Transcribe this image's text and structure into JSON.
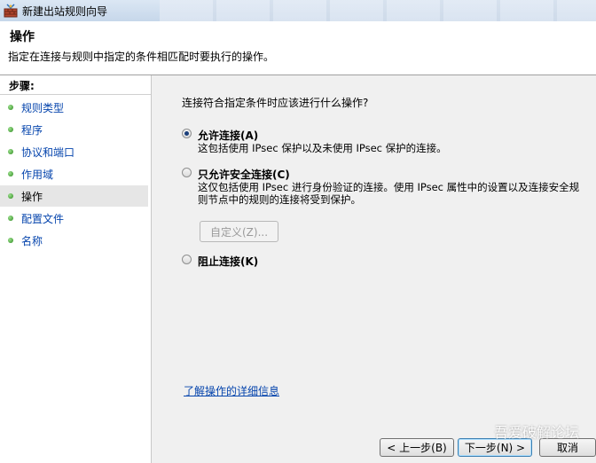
{
  "window": {
    "title": "新建出站规则向导"
  },
  "header": {
    "title": "操作",
    "description": "指定在连接与规则中指定的条件相匹配时要执行的操作。"
  },
  "steps": {
    "title": "步骤:",
    "items": [
      {
        "label": "规则类型"
      },
      {
        "label": "程序"
      },
      {
        "label": "协议和端口"
      },
      {
        "label": "作用域"
      },
      {
        "label": "操作"
      },
      {
        "label": "配置文件"
      },
      {
        "label": "名称"
      }
    ],
    "active_index": 4
  },
  "main": {
    "question": "连接符合指定条件时应该进行什么操作?",
    "options": [
      {
        "label": "允许连接(A)",
        "desc": "这包括使用 IPsec 保护以及未使用 IPsec 保护的连接。",
        "checked": true
      },
      {
        "label": "只允许安全连接(C)",
        "desc": "这仅包括使用 IPsec 进行身份验证的连接。使用 IPsec 属性中的设置以及连接安全规则节点中的规则的连接将受到保护。",
        "checked": false
      },
      {
        "label": "阻止连接(K)",
        "desc": "",
        "checked": false
      }
    ],
    "customize_label": "自定义(Z)...",
    "help_link": "了解操作的详细信息"
  },
  "footer": {
    "back_label": "< 上一步(B)",
    "next_label": "下一步(N) >",
    "cancel_label": "取消"
  },
  "watermark": "吾爱破解论坛"
}
